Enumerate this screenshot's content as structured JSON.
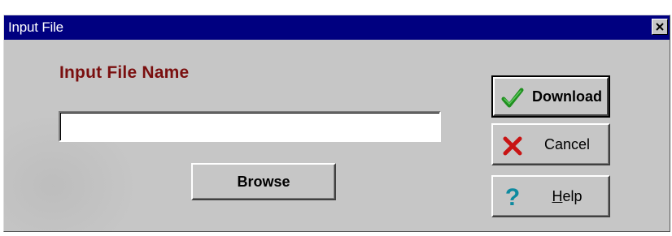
{
  "window": {
    "title": "Input File",
    "close_glyph": "×"
  },
  "form": {
    "field_label": "Input File Name",
    "file_name_value": "",
    "browse_label": "Browse"
  },
  "buttons": {
    "download_label": "Download",
    "cancel_label": "Cancel",
    "help_label_prefix": "",
    "help_mnemonic": "H",
    "help_label_rest": "elp",
    "help_icon_glyph": "?"
  },
  "icons": {
    "close": "close-icon",
    "download": "checkmark-icon",
    "cancel": "x-mark-icon",
    "help": "question-mark-icon"
  },
  "colors": {
    "titlebar": "#000080",
    "dialog_face": "#c6c6c6",
    "label_color": "#7a0f0f",
    "check_green": "#1f8f1f",
    "cancel_red": "#c81414",
    "help_teal": "#0d8aa0"
  }
}
